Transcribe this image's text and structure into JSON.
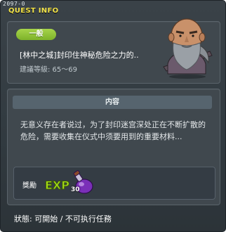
{
  "header": {
    "quest_id": "2097-0",
    "title": "QUEST INFO"
  },
  "quest": {
    "category": "一般",
    "name": "[林中之城]封印住神秘危险之力的..",
    "level_req": "建議等級: 65～69"
  },
  "content": {
    "header": "内容",
    "description": "无意义存在者说过，为了封印迷宫深处正在不断扩散的危险，需要收集在仪式中须要用到的重要材料..."
  },
  "reward": {
    "label": "獎勵",
    "exp_text": "EXP",
    "item_count": "30"
  },
  "status": "狀態: 可開始 / 不可执行任務",
  "colors": {
    "title": "#f2e34a",
    "badge": "#8fc23a",
    "window_bg": "#353d43",
    "exp": "#9ad21a"
  }
}
